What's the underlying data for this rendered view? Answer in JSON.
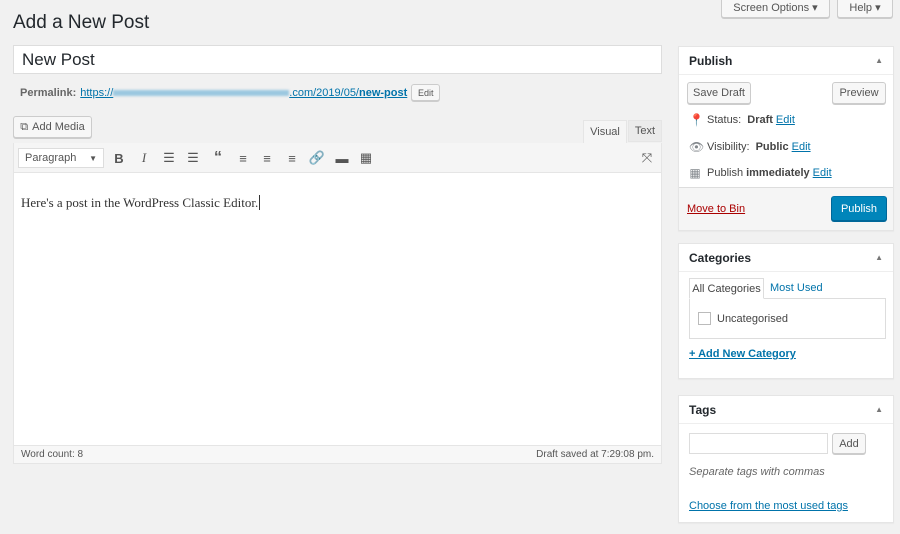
{
  "header": {
    "title": "Add a New Post",
    "screen_options": "Screen Options ▾",
    "help": "Help ▾"
  },
  "post": {
    "title": "New Post",
    "permalink_label": "Permalink:",
    "permalink_prefix": "https://",
    "permalink_suffix": ".com/2019/05/",
    "permalink_slug": "new-post",
    "edit_label": "Edit"
  },
  "editor": {
    "add_media": "Add Media",
    "tab_visual": "Visual",
    "tab_text": "Text",
    "format": "Paragraph",
    "content": "Here's a post in the WordPress Classic Editor.",
    "word_count": "Word count: 8",
    "draft_saved": "Draft saved at 7:29:08 pm.",
    "toolbar_icons": [
      "bold-icon",
      "italic-icon",
      "bulleted-list-icon",
      "numbered-list-icon",
      "blockquote-icon",
      "align-left-icon",
      "align-center-icon",
      "align-right-icon",
      "link-icon",
      "read-more-icon",
      "toolbar-toggle-icon",
      "fullscreen-icon"
    ]
  },
  "publish": {
    "title": "Publish",
    "save_draft": "Save Draft",
    "preview": "Preview",
    "status_label": "Status:",
    "status_value": "Draft",
    "visibility_label": "Visibility:",
    "visibility_value": "Public",
    "publish_label": "Publish",
    "publish_value": "immediately",
    "edit": "Edit",
    "move_to_bin": "Move to Bin",
    "publish_button": "Publish"
  },
  "categories": {
    "title": "Categories",
    "tab_all": "All Categories",
    "tab_most_used": "Most Used",
    "items": [
      {
        "label": "Uncategorised",
        "checked": false
      }
    ],
    "add_new": "+ Add New Category"
  },
  "tags": {
    "title": "Tags",
    "input_value": "",
    "add": "Add",
    "hint": "Separate tags with commas",
    "choose": "Choose from the most used tags"
  },
  "colors": {
    "accent": "#0073aa",
    "publish_button": "#0085ba",
    "trash": "#a00"
  }
}
